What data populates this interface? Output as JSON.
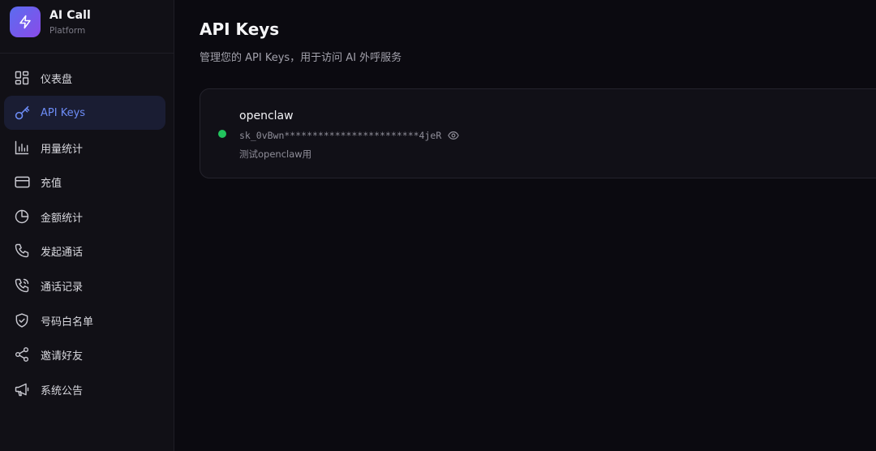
{
  "brand": {
    "name": "AI Call",
    "subtitle": "Platform",
    "logo_icon": "lightning-icon",
    "gradient": [
      "#5b6cf0",
      "#8a4be8"
    ]
  },
  "sidebar": {
    "active_color": "#6d8df7",
    "items": [
      {
        "label": "仪表盘",
        "icon": "dashboard-icon",
        "active": false
      },
      {
        "label": "API Keys",
        "icon": "key-icon",
        "active": true
      },
      {
        "label": "用量统计",
        "icon": "bar-chart-icon",
        "active": false
      },
      {
        "label": "充值",
        "icon": "credit-card-icon",
        "active": false
      },
      {
        "label": "金额统计",
        "icon": "pie-chart-icon",
        "active": false
      },
      {
        "label": "发起通话",
        "icon": "phone-icon",
        "active": false
      },
      {
        "label": "通话记录",
        "icon": "phone-call-icon",
        "active": false
      },
      {
        "label": "号码白名单",
        "icon": "shield-check-icon",
        "active": false
      },
      {
        "label": "邀请好友",
        "icon": "share-icon",
        "active": false
      },
      {
        "label": "系统公告",
        "icon": "megaphone-icon",
        "active": false
      }
    ]
  },
  "main": {
    "title": "API Keys",
    "subtitle": "管理您的 API Keys，用于访问 AI 外呼服务",
    "keys": [
      {
        "name": "openclaw",
        "masked_key": "sk_0vBwn************************4jeR",
        "description": "测试openclaw用",
        "status": "active",
        "status_color": "#22c55e",
        "reveal_icon": "eye-icon"
      }
    ]
  }
}
